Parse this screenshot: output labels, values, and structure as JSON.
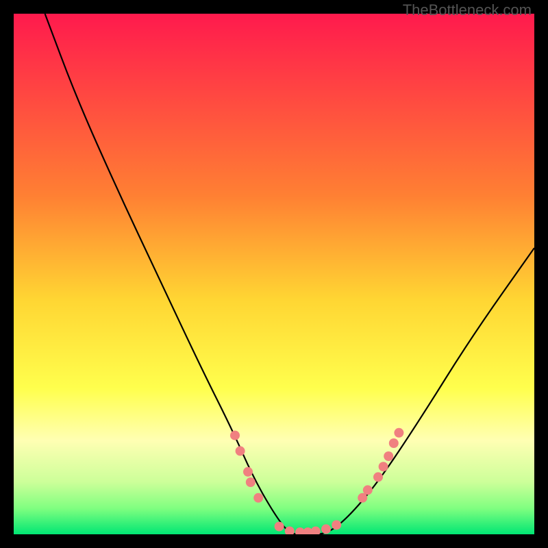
{
  "watermark": "TheBottleneck.com",
  "chart_data": {
    "type": "line",
    "title": "",
    "xlabel": "",
    "ylabel": "",
    "xlim": [
      0,
      100
    ],
    "ylim": [
      0,
      100
    ],
    "gradient_stops": [
      {
        "offset": 0,
        "color": "#ff1a4d"
      },
      {
        "offset": 35,
        "color": "#ff8033"
      },
      {
        "offset": 55,
        "color": "#ffd633"
      },
      {
        "offset": 72,
        "color": "#ffff4d"
      },
      {
        "offset": 82,
        "color": "#ffffb3"
      },
      {
        "offset": 90,
        "color": "#ccff99"
      },
      {
        "offset": 95,
        "color": "#80ff80"
      },
      {
        "offset": 100,
        "color": "#00e673"
      }
    ],
    "series": [
      {
        "name": "bottleneck-curve",
        "x": [
          6,
          12,
          20,
          28,
          36,
          42,
          46,
          50,
          53,
          56,
          60,
          64,
          70,
          78,
          88,
          100
        ],
        "values": [
          100,
          84,
          66,
          49,
          32,
          20,
          11,
          4,
          0,
          0,
          0,
          3,
          10,
          22,
          38,
          55
        ]
      }
    ],
    "markers": {
      "name": "highlight-points",
      "color": "#f08080",
      "radius": 7,
      "points": [
        {
          "x": 42.5,
          "y": 19
        },
        {
          "x": 43.5,
          "y": 16
        },
        {
          "x": 45,
          "y": 12
        },
        {
          "x": 45.5,
          "y": 10
        },
        {
          "x": 47,
          "y": 7
        },
        {
          "x": 51,
          "y": 1.5
        },
        {
          "x": 53,
          "y": 0.6
        },
        {
          "x": 55,
          "y": 0.4
        },
        {
          "x": 56.5,
          "y": 0.4
        },
        {
          "x": 58,
          "y": 0.6
        },
        {
          "x": 60,
          "y": 1
        },
        {
          "x": 62,
          "y": 1.8
        },
        {
          "x": 67,
          "y": 7
        },
        {
          "x": 68,
          "y": 8.5
        },
        {
          "x": 70,
          "y": 11
        },
        {
          "x": 71,
          "y": 13
        },
        {
          "x": 72,
          "y": 15
        },
        {
          "x": 73,
          "y": 17.5
        },
        {
          "x": 74,
          "y": 19.5
        }
      ]
    }
  }
}
